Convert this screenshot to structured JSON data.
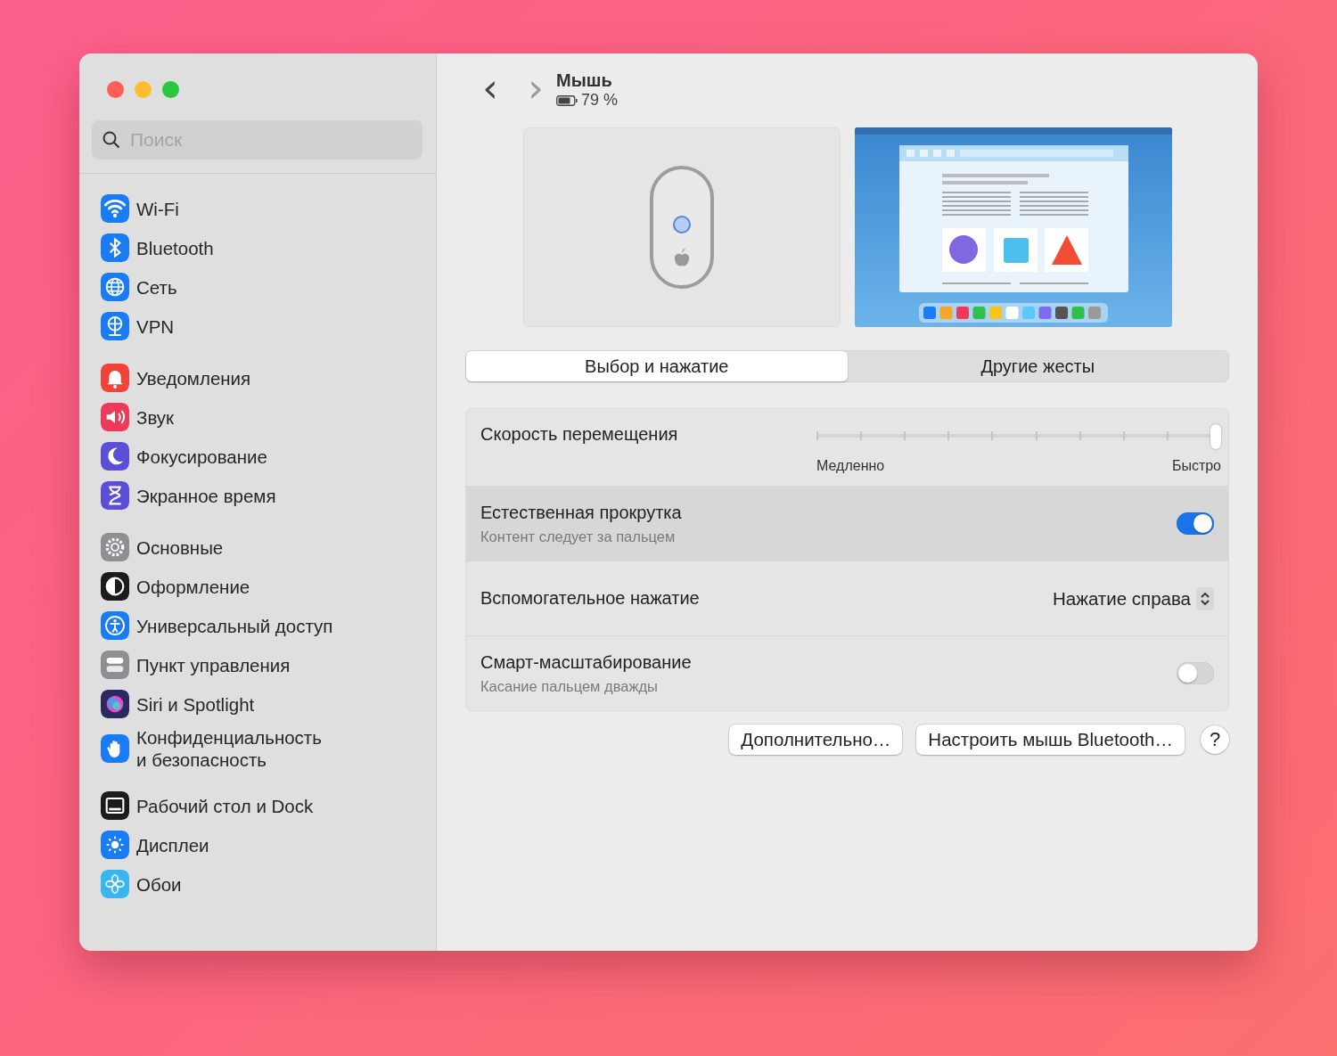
{
  "sidebar": {
    "search": {
      "placeholder": "Поиск"
    },
    "groups": [
      {
        "items": [
          {
            "label": "Wi-Fi",
            "kind": "wifi",
            "color": "#1a7cf5"
          },
          {
            "label": "Bluetooth",
            "kind": "bluetooth",
            "color": "#1a7cf5"
          },
          {
            "label": "Сеть",
            "kind": "globe",
            "color": "#1a7cf5"
          },
          {
            "label": "VPN",
            "kind": "vpn",
            "color": "#1a7cf5"
          }
        ]
      },
      {
        "items": [
          {
            "label": "Уведомления",
            "kind": "bell",
            "color": "#f0443a"
          },
          {
            "label": "Звук",
            "kind": "speaker",
            "color": "#ee3a5a"
          },
          {
            "label": "Фокусирование",
            "kind": "moon",
            "color": "#5a4fd6"
          },
          {
            "label": "Экранное время",
            "kind": "hourglass",
            "color": "#5a4fd6"
          }
        ]
      },
      {
        "items": [
          {
            "label": "Основные",
            "kind": "gear",
            "color": "#8e8e93"
          },
          {
            "label": "Оформление",
            "kind": "appearance",
            "color": "#1c1c1e"
          },
          {
            "label": "Универсальный доступ",
            "kind": "accessibility",
            "color": "#1a7cf5"
          },
          {
            "label": "Пункт управления",
            "kind": "switches",
            "color": "#8e8e93"
          },
          {
            "label": "Siri и Spotlight",
            "kind": "siri",
            "color": "#2a2a5e"
          },
          {
            "label": "Конфиденциальность\nи безопасность",
            "kind": "hand",
            "color": "#1a7cf5"
          }
        ]
      },
      {
        "items": [
          {
            "label": "Рабочий стол и Dock",
            "kind": "dock",
            "color": "#1c1c1e"
          },
          {
            "label": "Дисплеи",
            "kind": "sun",
            "color": "#1a7cf5"
          },
          {
            "label": "Обои",
            "kind": "flower",
            "color": "#38b6f0"
          }
        ]
      }
    ]
  },
  "header": {
    "back": "‹",
    "forward": "›",
    "title": "Мышь",
    "battery": "79 %"
  },
  "tabs": [
    {
      "label": "Выбор и нажатие",
      "selected": true
    },
    {
      "label": "Другие жесты",
      "selected": false
    }
  ],
  "settings": [
    {
      "kind": "slider",
      "label": "Скорость перемещения",
      "level": 1.0,
      "min_label": "Медленно",
      "max_label": "Быстро"
    },
    {
      "kind": "toggle",
      "label": "Естественная прокрутка",
      "hint": "Контент следует за пальцем",
      "on": true,
      "highlighted": true
    },
    {
      "kind": "select",
      "label": "Вспомогательное нажатие",
      "value": "Нажатие справа"
    },
    {
      "kind": "toggle",
      "label": "Смарт-масштабирование",
      "hint": "Касание пальцем дважды",
      "on": false,
      "highlighted": false
    }
  ],
  "buttons": [
    "Дополнительно…",
    "Настроить мышь Bluetooth…"
  ],
  "help": "?"
}
